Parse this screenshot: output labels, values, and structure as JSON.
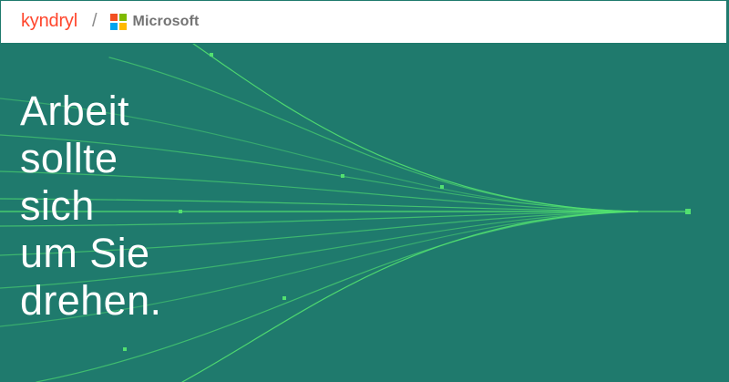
{
  "header": {
    "brand_left": "kyndryl",
    "separator": "/",
    "brand_right": "Microsoft"
  },
  "colors": {
    "background": "#1f7a6d",
    "header_bg": "#ffffff",
    "kyndryl_red": "#ff462d",
    "line_green": "#52e070",
    "ms_red": "#f25022",
    "ms_green": "#7fba00",
    "ms_blue": "#00a4ef",
    "ms_yellow": "#ffb900"
  },
  "icons": {
    "microsoft": "microsoft-four-squares-icon"
  },
  "hero": {
    "headline_lines": [
      "Arbeit",
      "sollte",
      "sich",
      "um Sie",
      "drehen."
    ]
  }
}
